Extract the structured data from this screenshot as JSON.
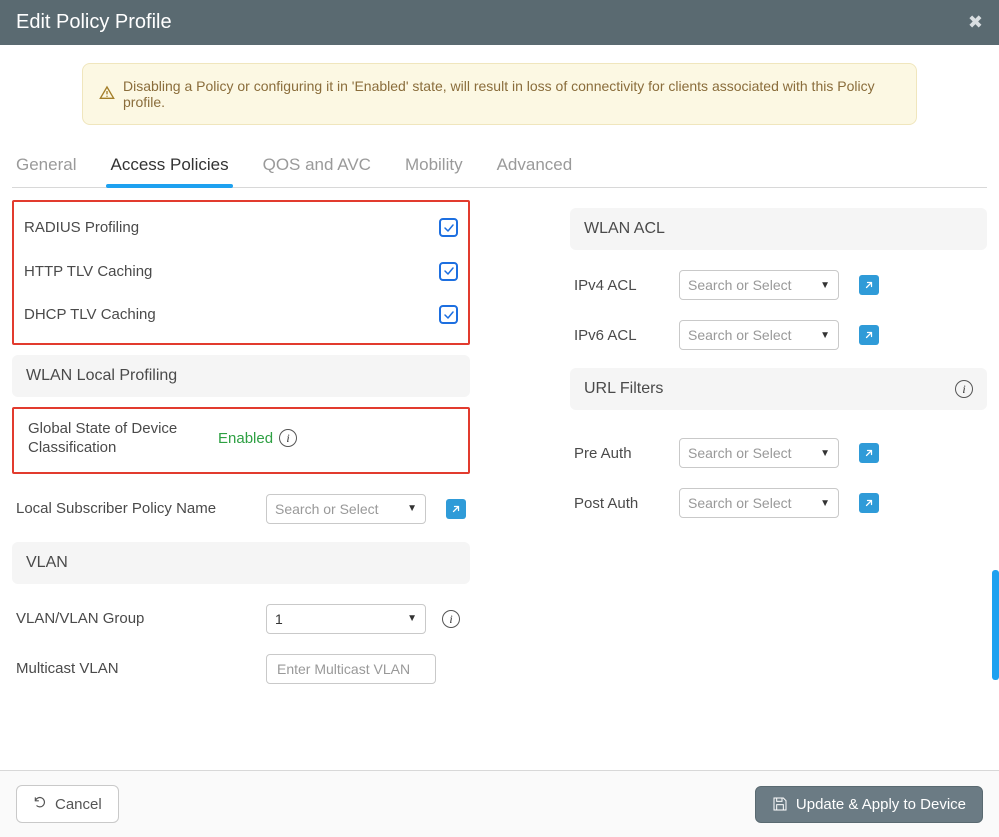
{
  "header": {
    "title": "Edit Policy Profile"
  },
  "alert": {
    "text": "Disabling a Policy or configuring it in 'Enabled' state, will result in loss of connectivity for clients associated with this Policy profile."
  },
  "tabs": {
    "general": "General",
    "access_policies": "Access Policies",
    "qos": "QOS and AVC",
    "mobility": "Mobility",
    "advanced": "Advanced",
    "active": "access_policies"
  },
  "left": {
    "radius_profiling": {
      "label": "RADIUS Profiling",
      "checked": true
    },
    "http_tlv": {
      "label": "HTTP TLV Caching",
      "checked": true
    },
    "dhcp_tlv": {
      "label": "DHCP TLV Caching",
      "checked": true
    },
    "section_wlp": "WLAN Local Profiling",
    "global_state": {
      "label": "Global State of Device Classification",
      "status": "Enabled"
    },
    "local_subscriber": {
      "label": "Local Subscriber Policy Name",
      "placeholder": "Search or Select"
    },
    "section_vlan": "VLAN",
    "vlan_group": {
      "label": "VLAN/VLAN Group",
      "value": "1"
    },
    "multicast_vlan": {
      "label": "Multicast VLAN",
      "placeholder": "Enter Multicast VLAN"
    }
  },
  "right": {
    "section_wlan_acl": "WLAN ACL",
    "ipv4_acl": {
      "label": "IPv4 ACL",
      "placeholder": "Search or Select"
    },
    "ipv6_acl": {
      "label": "IPv6 ACL",
      "placeholder": "Search or Select"
    },
    "section_url_filters": "URL Filters",
    "pre_auth": {
      "label": "Pre Auth",
      "placeholder": "Search or Select"
    },
    "post_auth": {
      "label": "Post Auth",
      "placeholder": "Search or Select"
    }
  },
  "footer": {
    "cancel": "Cancel",
    "apply": "Update & Apply to Device"
  }
}
